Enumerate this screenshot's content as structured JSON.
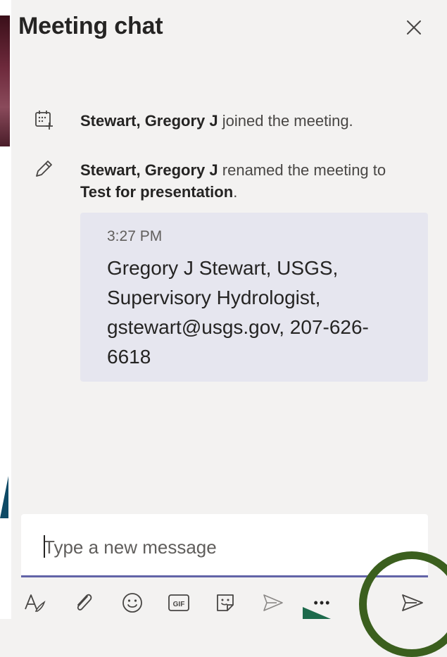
{
  "header": {
    "title": "Meeting chat",
    "close_icon": "close-icon"
  },
  "events": [
    {
      "icon": "calendar-add-icon",
      "actor": "Stewart, Gregory J",
      "text": "joined the meeting."
    },
    {
      "icon": "pencil-icon",
      "actor": "Stewart, Gregory J",
      "text": "renamed the meeting to",
      "target": "Test for presentation",
      "end": "."
    }
  ],
  "message": {
    "time": "3:27 PM",
    "lines": [
      "Gregory J Stewart, USGS,",
      "Supervisory Hydrologist,",
      "gstewart@usgs.gov, 207-626-",
      "6618"
    ]
  },
  "compose": {
    "placeholder": "Type a new message",
    "value": ""
  },
  "toolbar": {
    "items": [
      "format-icon",
      "attach-icon",
      "emoji-icon",
      "gif-icon",
      "sticker-icon",
      "praise-icon",
      "more-options-icon",
      "send-icon"
    ],
    "gif_label": "GIF",
    "more_label": "•••"
  },
  "colors": {
    "accent": "#6264a7",
    "card_bg": "#e6e6ef",
    "panel_bg": "#f3f2f1",
    "ring": "#3b5f1e",
    "slide_shape": "#0e4a66"
  }
}
